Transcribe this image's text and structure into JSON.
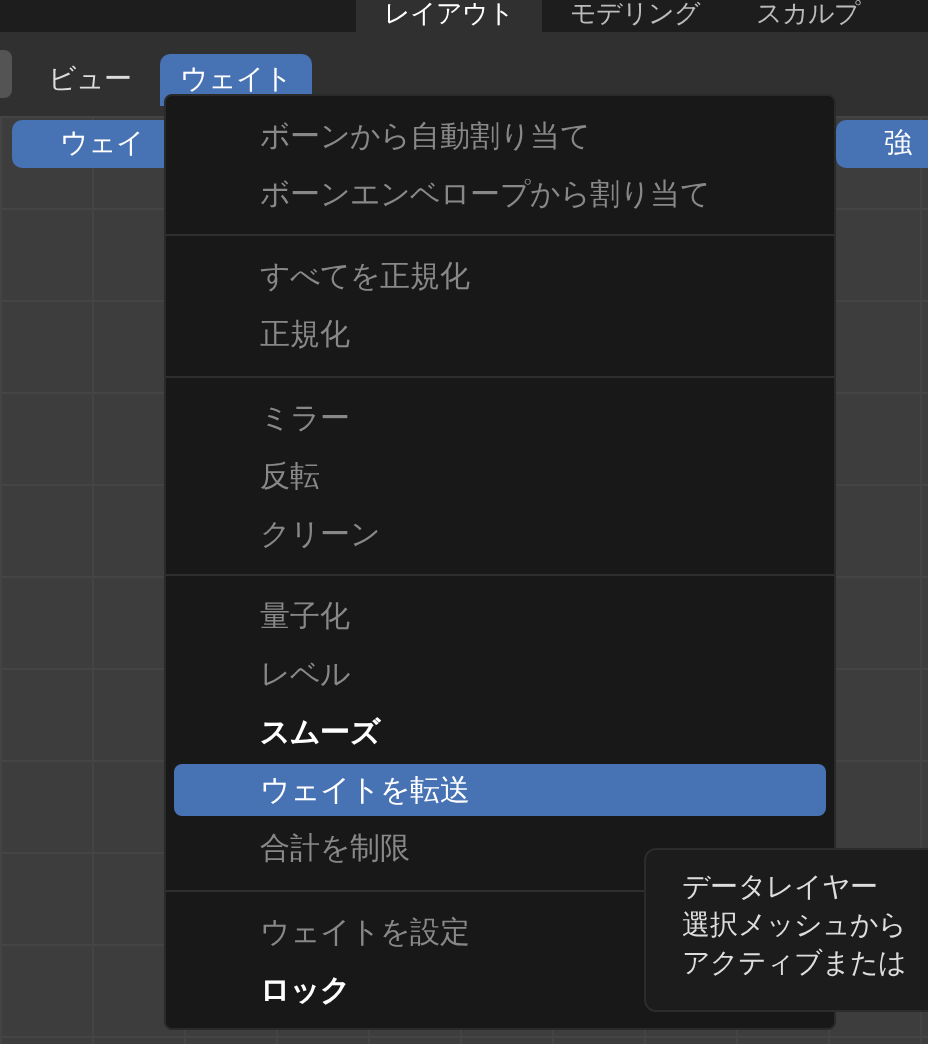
{
  "workspace_tabs": [
    {
      "label": "レイアウト",
      "selected": true
    },
    {
      "label": "モデリング",
      "selected": false
    },
    {
      "label": "スカルプ",
      "selected": false
    }
  ],
  "header_menus": [
    {
      "label": "ビュー",
      "selected": false
    },
    {
      "label": "ウェイト",
      "selected": true
    }
  ],
  "tool_buttons": [
    {
      "label": "ウェイ"
    },
    {
      "label": "強"
    }
  ],
  "menu": {
    "groups": [
      [
        {
          "label": "ボーンから自動割り当て",
          "disabled": true,
          "selected": false
        },
        {
          "label": "ボーンエンベロープから割り当て",
          "disabled": true,
          "selected": false
        }
      ],
      [
        {
          "label": "すべてを正規化",
          "disabled": true,
          "selected": false
        },
        {
          "label": "正規化",
          "disabled": true,
          "selected": false
        }
      ],
      [
        {
          "label": "ミラー",
          "disabled": true,
          "selected": false
        },
        {
          "label": "反転",
          "disabled": true,
          "selected": false
        },
        {
          "label": "クリーン",
          "disabled": true,
          "selected": false
        }
      ],
      [
        {
          "label": "量子化",
          "disabled": true,
          "selected": false
        },
        {
          "label": "レベル",
          "disabled": true,
          "selected": false
        },
        {
          "label": "スムーズ",
          "disabled": false,
          "selected": false
        },
        {
          "label": "ウェイトを転送",
          "disabled": false,
          "selected": true
        },
        {
          "label": "合計を制限",
          "disabled": true,
          "selected": false
        }
      ],
      [
        {
          "label": "ウェイトを設定",
          "disabled": true,
          "selected": false
        },
        {
          "label": "ロック",
          "disabled": false,
          "selected": false
        }
      ]
    ]
  },
  "tooltip": {
    "lines": [
      "データレイヤー",
      "選択メッシュから",
      "アクティブまたは"
    ]
  }
}
